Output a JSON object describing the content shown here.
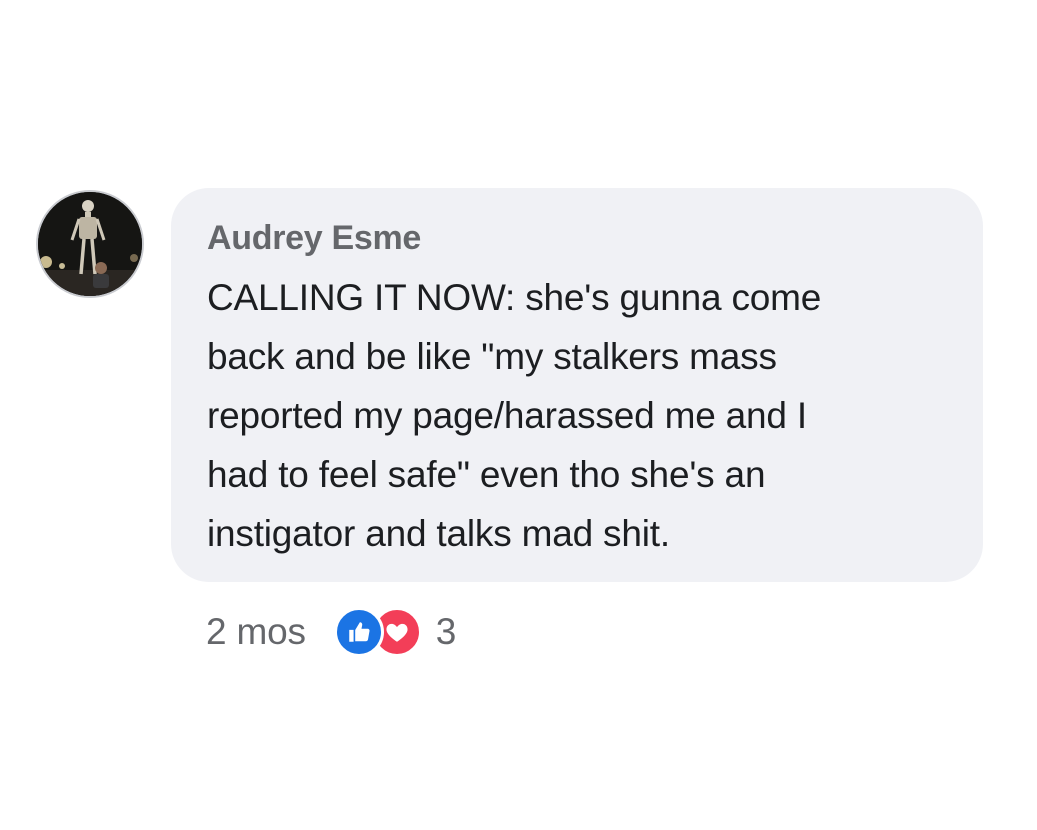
{
  "comment": {
    "author": "Audrey Esme",
    "lines": [
      "CALLING IT NOW: she's gunna come",
      "back and be like \"my stalkers mass",
      "reported my page/harassed me and I",
      "had to feel safe\" even tho she's an",
      "instigator and talks mad shit."
    ],
    "timestamp": "2 mos",
    "reactions": {
      "types": [
        "like-icon",
        "love-icon"
      ],
      "count": "3"
    }
  },
  "colors": {
    "bubble": "#f0f1f5",
    "author": "#65676b",
    "text": "#1c1e21",
    "like": "#1b74e4",
    "love": "#f33e58"
  }
}
